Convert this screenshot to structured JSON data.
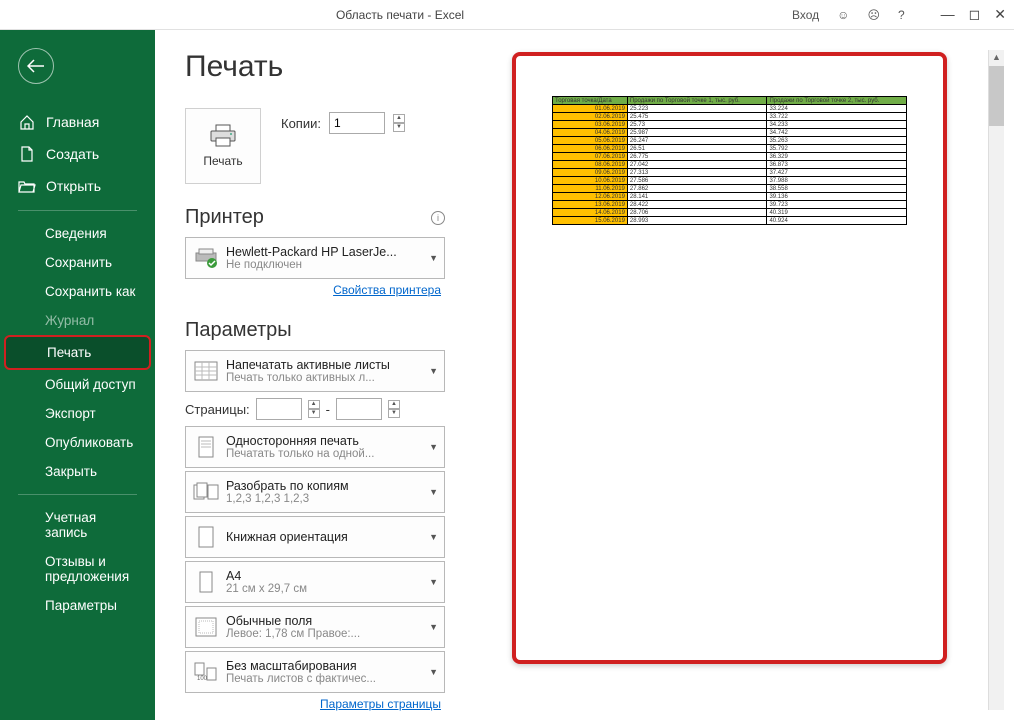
{
  "titlebar": {
    "title": "Область печати - Excel",
    "login": "Вход"
  },
  "sidebar": {
    "home": "Главная",
    "create": "Создать",
    "open": "Открыть",
    "info": "Сведения",
    "save": "Сохранить",
    "saveas": "Сохранить как",
    "history": "Журнал",
    "print": "Печать",
    "share": "Общий доступ",
    "export": "Экспорт",
    "publish": "Опубликовать",
    "close": "Закрыть",
    "account": "Учетная запись",
    "feedback": "Отзывы и предложения",
    "options": "Параметры"
  },
  "page": {
    "title": "Печать",
    "print_btn": "Печать",
    "copies_label": "Копии:",
    "copies_value": "1"
  },
  "printer": {
    "section": "Принтер",
    "name": "Hewlett-Packard HP LaserJe...",
    "status": "Не подключен",
    "props_link": "Свойства принтера"
  },
  "params": {
    "section": "Параметры",
    "sheets_title": "Напечатать активные листы",
    "sheets_sub": "Печать только активных л...",
    "pages_label": "Страницы:",
    "pages_sep": "-",
    "duplex_title": "Односторонняя печать",
    "duplex_sub": "Печатать только на одной...",
    "collate_title": "Разобрать по копиям",
    "collate_sub": "1,2,3   1,2,3   1,2,3",
    "orient_title": "Книжная ориентация",
    "size_title": "A4",
    "size_sub": "21 см x 29,7 см",
    "margins_title": "Обычные поля",
    "margins_sub": "Левое: 1,78 см  Правое:...",
    "scale_title": "Без масштабирования",
    "scale_sub": "Печать листов с фактичес...",
    "pagesetup_link": "Параметры страницы"
  },
  "chart_data": {
    "type": "table",
    "headers": [
      "Торговая точка/Дата",
      "Продажи по Торговой точке 1, тыс. руб.",
      "Продажи по Торговой точке 2, тыс. руб."
    ],
    "rows": [
      [
        "01.06.2019",
        "25.223",
        "33.224"
      ],
      [
        "02.06.2019",
        "25.475",
        "33.722"
      ],
      [
        "03.06.2019",
        "25.73",
        "34.233"
      ],
      [
        "04.06.2019",
        "25.987",
        "34.742"
      ],
      [
        "05.06.2019",
        "26.247",
        "35.263"
      ],
      [
        "06.06.2019",
        "26.51",
        "35.792"
      ],
      [
        "07.06.2019",
        "26.775",
        "36.329"
      ],
      [
        "08.06.2019",
        "27.042",
        "36.873"
      ],
      [
        "09.06.2019",
        "27.313",
        "37.427"
      ],
      [
        "10.06.2019",
        "27.586",
        "37.988"
      ],
      [
        "11.06.2019",
        "27.862",
        "38.558"
      ],
      [
        "12.06.2019",
        "28.141",
        "39.136"
      ],
      [
        "13.06.2019",
        "28.422",
        "39.723"
      ],
      [
        "14.06.2019",
        "28.706",
        "40.319"
      ],
      [
        "15.06.2019",
        "28.993",
        "40.924"
      ]
    ]
  }
}
